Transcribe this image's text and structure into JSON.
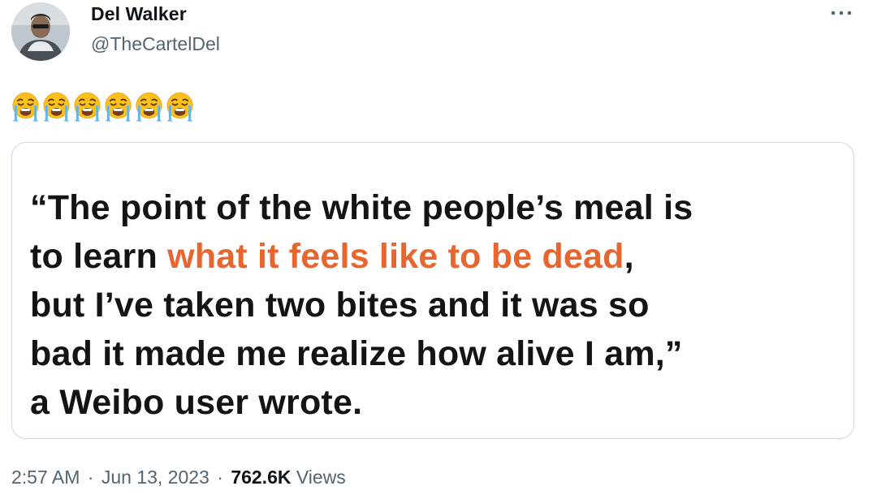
{
  "author": {
    "name": "Del Walker",
    "handle": "@TheCartelDel"
  },
  "tweet": {
    "emoji_icon": "loudly-crying-face-icon",
    "emoji_count": 6,
    "emoji_text": "😭😭😭😭😭😭"
  },
  "quote_card": {
    "line1": "“The point of the white people’s meal is",
    "line2_before": "to learn ",
    "line2_highlight": "what it feels like to be dead",
    "line2_after": ",",
    "line3": "but I’ve taken two bites and it was so",
    "line4": "bad it made me realize how alive I am,”",
    "line5": "a Weibo user wrote.",
    "highlight_color": "#e7662f"
  },
  "meta": {
    "time": "2:57 AM",
    "separator": "·",
    "date": "Jun 13, 2023",
    "views_count": "762.6K",
    "views_label": "Views"
  },
  "colors": {
    "secondary_text": "#536471",
    "primary_text": "#0f1419",
    "card_border": "#cfd9de"
  }
}
